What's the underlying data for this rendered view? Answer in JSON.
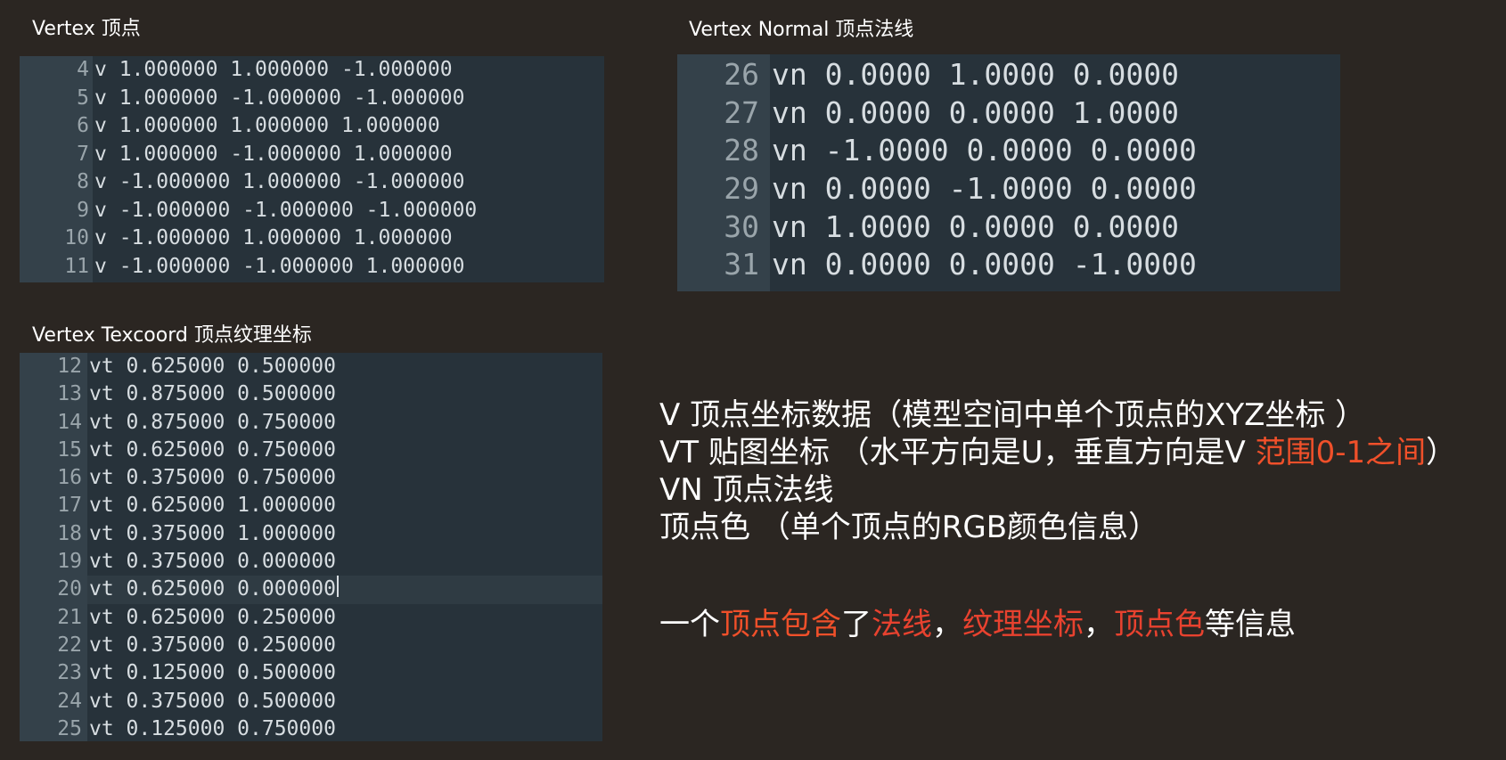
{
  "vertex": {
    "title": "Vertex 顶点",
    "line_numbers": [
      "4",
      "5",
      "6",
      "7",
      "8",
      "9",
      "10",
      "11"
    ],
    "lines": [
      "v 1.000000 1.000000 -1.000000",
      "v 1.000000 -1.000000 -1.000000",
      "v 1.000000 1.000000 1.000000",
      "v 1.000000 -1.000000 1.000000",
      "v -1.000000 1.000000 -1.000000",
      "v -1.000000 -1.000000 -1.000000",
      "v -1.000000 1.000000 1.000000",
      "v -1.000000 -1.000000 1.000000"
    ]
  },
  "normal": {
    "title": "Vertex Normal 顶点法线",
    "line_numbers": [
      "26",
      "27",
      "28",
      "29",
      "30",
      "31"
    ],
    "lines": [
      "vn 0.0000 1.0000 0.0000",
      "vn 0.0000 0.0000 1.0000",
      "vn -1.0000 0.0000 0.0000",
      "vn 0.0000 -1.0000 0.0000",
      "vn 1.0000 0.0000 0.0000",
      "vn 0.0000 0.0000 -1.0000"
    ]
  },
  "texcoord": {
    "title": "Vertex Texcoord 顶点纹理坐标",
    "line_numbers": [
      "12",
      "13",
      "14",
      "15",
      "16",
      "17",
      "18",
      "19",
      "20",
      "21",
      "22",
      "23",
      "24",
      "25"
    ],
    "lines": [
      "vt 0.625000 0.500000",
      "vt 0.875000 0.500000",
      "vt 0.875000 0.750000",
      "vt 0.625000 0.750000",
      "vt 0.375000 0.750000",
      "vt 0.625000 1.000000",
      "vt 0.375000 1.000000",
      "vt 0.375000 0.000000",
      "vt 0.625000 0.000000",
      "vt 0.625000 0.250000",
      "vt 0.375000 0.250000",
      "vt 0.125000 0.500000",
      "vt 0.375000 0.500000",
      "vt 0.125000 0.750000"
    ],
    "active_line": "20"
  },
  "description": {
    "line1": "V 顶点坐标数据（模型空间中单个顶点的XYZ坐标 ）",
    "line2_main": "VT 贴图坐标 （水平方向是U，垂直方向是V ",
    "line2_highlight": "范围0-1之间",
    "line2_end": "）",
    "line3": "VN 顶点法线",
    "line4": "顶点色 （单个顶点的RGB颜色信息）",
    "summary": {
      "p1": "一个",
      "p2": "顶点包含",
      "p3": "了",
      "p4": "法线",
      "p5": "，",
      "p6": "纹理坐标",
      "p7": "，",
      "p8": "顶点色",
      "p9": "等信息"
    }
  },
  "colors": {
    "background": "#2b2622",
    "editor_bg": "#27323a",
    "gutter_bg": "#34414a",
    "highlight": "#f0502a"
  }
}
